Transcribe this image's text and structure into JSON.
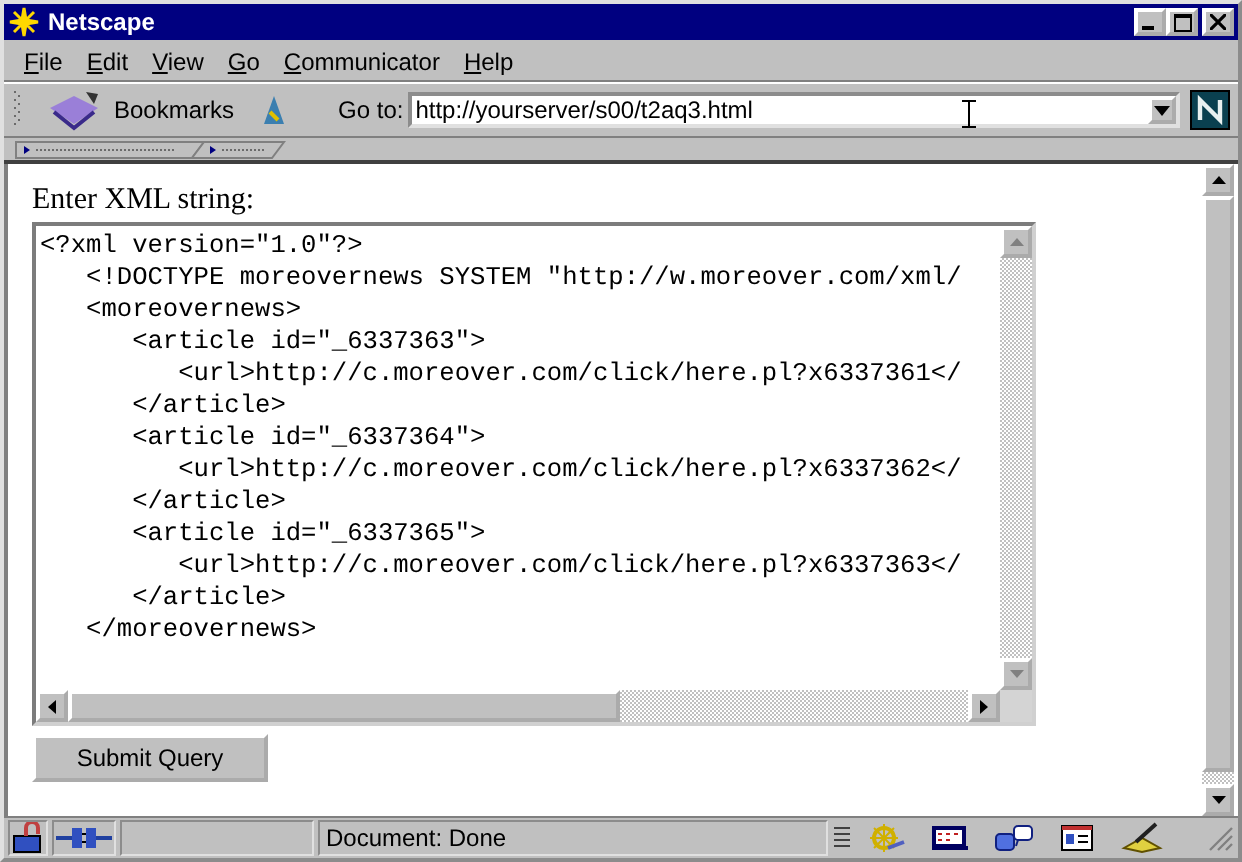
{
  "window": {
    "title": "Netscape"
  },
  "menu": [
    "File",
    "Edit",
    "View",
    "Go",
    "Communicator",
    "Help"
  ],
  "toolbar": {
    "bookmarks": "Bookmarks",
    "goto_label": "Go to:",
    "url": "http://yourserver/s00/t2aq3.html"
  },
  "form": {
    "label": "Enter XML string:",
    "lines": [
      "<?xml version=\"1.0\"?>",
      "   <!DOCTYPE moreovernews SYSTEM \"http://w.moreover.com/xml/",
      "   <moreovernews>",
      "      <article id=\"_6337363\">",
      "         <url>http://c.moreover.com/click/here.pl?x6337361</",
      "      </article>",
      "      <article id=\"_6337364\">",
      "         <url>http://c.moreover.com/click/here.pl?x6337362</",
      "      </article>",
      "      <article id=\"_6337365\">",
      "         <url>http://c.moreover.com/click/here.pl?x6337363</",
      "      </article>",
      "   </moreovernews>"
    ],
    "button": "Submit Query"
  },
  "status_bar": {
    "text": "Document: Done"
  }
}
